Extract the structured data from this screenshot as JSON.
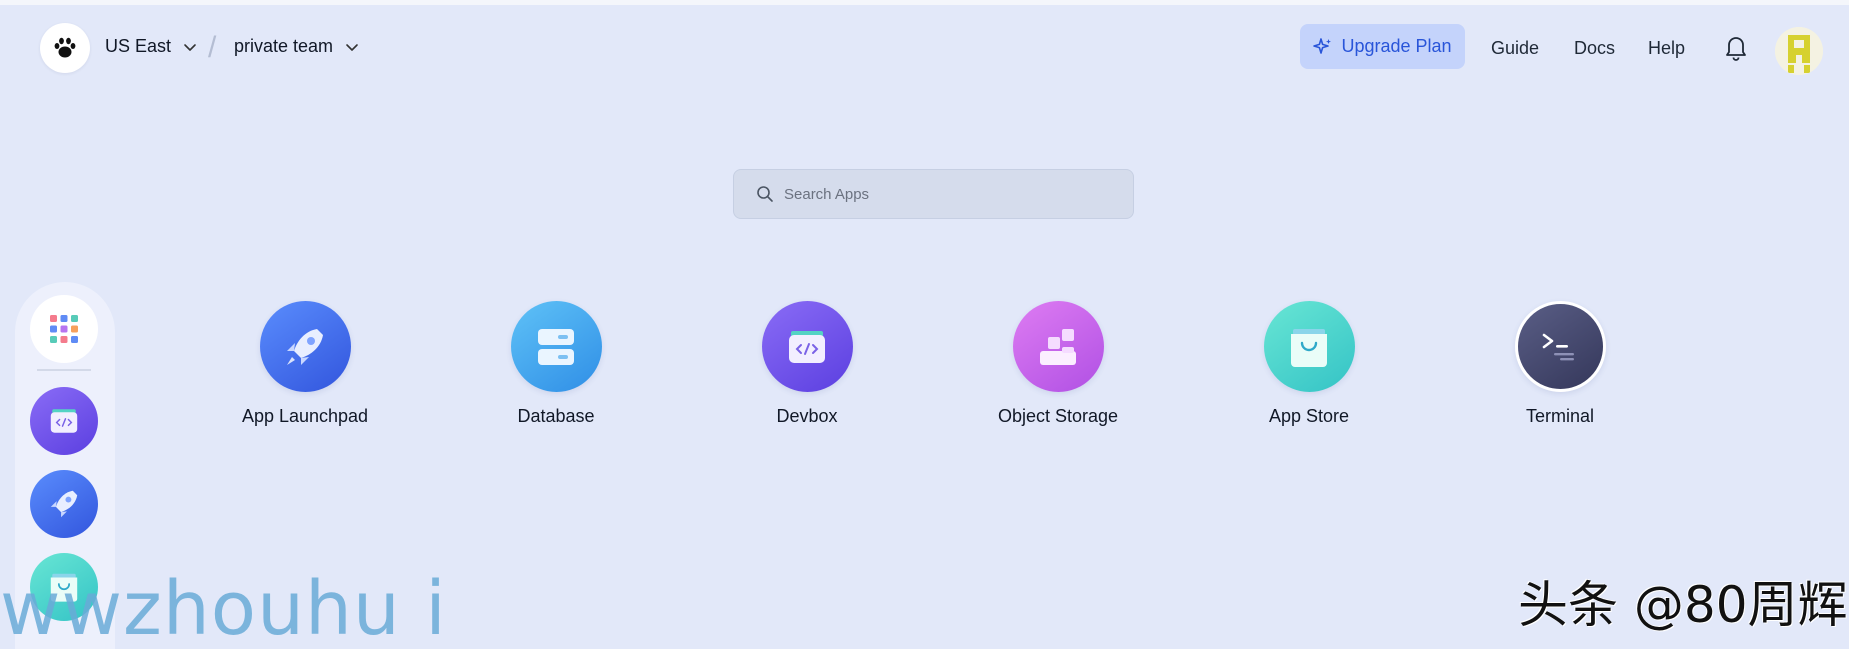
{
  "header": {
    "region": "US East",
    "team": "private team",
    "upgrade_label": "Upgrade Plan",
    "links": [
      "Guide",
      "Docs",
      "Help"
    ]
  },
  "search": {
    "placeholder": "Search Apps"
  },
  "apps": [
    {
      "label": "App Launchpad",
      "icon": "rocket-icon"
    },
    {
      "label": "Database",
      "icon": "database-icon"
    },
    {
      "label": "Devbox",
      "icon": "devbox-code-icon"
    },
    {
      "label": "Object Storage",
      "icon": "object-storage-icon"
    },
    {
      "label": "App Store",
      "icon": "shopping-bag-icon"
    },
    {
      "label": "Terminal",
      "icon": "terminal-icon"
    }
  ],
  "dock": {
    "items": [
      "app-grid-icon",
      "devbox-code-icon",
      "rocket-icon",
      "shopping-bag-icon"
    ]
  },
  "watermarks": {
    "left": "wwzhouhu i",
    "right": "头条 @80周辉"
  },
  "colors": {
    "background": "#e2e8f9",
    "accent": "#2955d9",
    "upgrade_bg": "#c4d3fb"
  }
}
